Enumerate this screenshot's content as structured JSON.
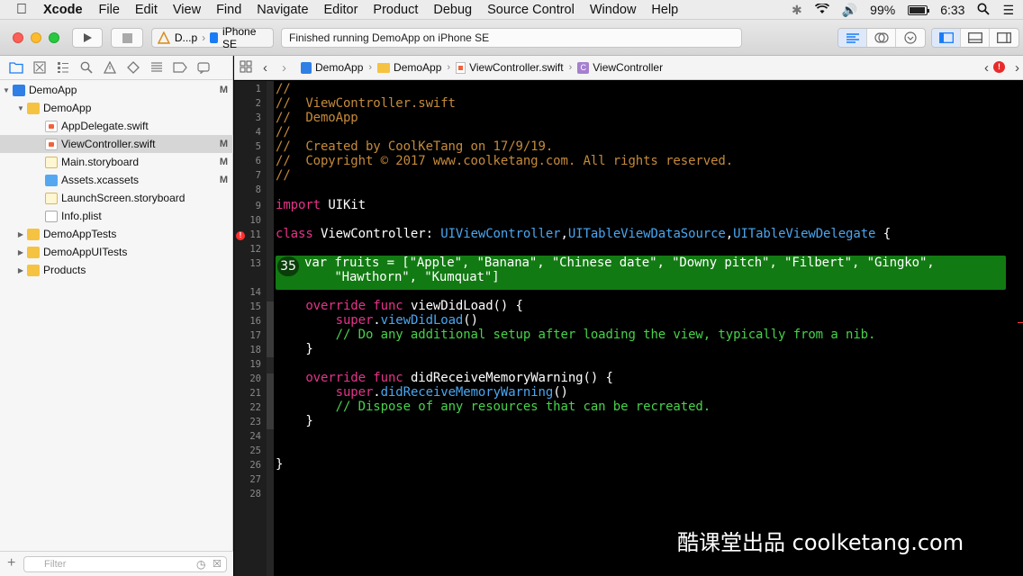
{
  "menubar": {
    "app": "Xcode",
    "items": [
      "File",
      "Edit",
      "View",
      "Find",
      "Navigate",
      "Editor",
      "Product",
      "Debug",
      "Source Control",
      "Window",
      "Help"
    ],
    "battery": "99%",
    "time": "6:33"
  },
  "toolbar": {
    "scheme_target": "D...p",
    "scheme_device": "iPhone SE",
    "status": "Finished running DemoApp on iPhone SE"
  },
  "navigator": {
    "rows": [
      {
        "label": "DemoApp",
        "status": "M",
        "icon": "project-icon"
      },
      {
        "label": "DemoApp",
        "status": "",
        "icon": "folder-icon"
      },
      {
        "label": "AppDelegate.swift",
        "status": "",
        "icon": "swift-file-icon"
      },
      {
        "label": "ViewController.swift",
        "status": "M",
        "icon": "swift-file-icon"
      },
      {
        "label": "Main.storyboard",
        "status": "M",
        "icon": "storyboard-icon"
      },
      {
        "label": "Assets.xcassets",
        "status": "M",
        "icon": "asset-catalog-icon"
      },
      {
        "label": "LaunchScreen.storyboard",
        "status": "",
        "icon": "storyboard-icon"
      },
      {
        "label": "Info.plist",
        "status": "",
        "icon": "plist-icon"
      },
      {
        "label": "DemoAppTests",
        "status": "",
        "icon": "folder-icon"
      },
      {
        "label": "DemoAppUITests",
        "status": "",
        "icon": "folder-icon"
      },
      {
        "label": "Products",
        "status": "",
        "icon": "folder-icon"
      }
    ],
    "filter_placeholder": "Filter"
  },
  "jumpbar": {
    "crumbs": [
      "DemoApp",
      "DemoApp",
      "ViewController.swift",
      "ViewController"
    ]
  },
  "editor": {
    "line_numbers": [
      "1",
      "2",
      "3",
      "4",
      "5",
      "6",
      "7",
      "8",
      "9",
      "10",
      "11",
      "12",
      "13",
      "14",
      "15",
      "16",
      "17",
      "18",
      "19",
      "20",
      "21",
      "22",
      "23",
      "24",
      "25",
      "26",
      "27",
      "28"
    ],
    "lines": {
      "l1": "//",
      "l2": "//  ViewController.swift",
      "l3": "//  DemoApp",
      "l4": "//",
      "l5": "//  Created by CoolKeTang on 17/9/19.",
      "l6": "//  Copyright © 2017 www.coolketang.com. All rights reserved.",
      "l7": "//",
      "l9_kw": "import",
      "l9_rest": " UIKit",
      "l11_kw": "class",
      "l11_name": " ViewController: ",
      "l11_t1": "UIViewController",
      "l11_t2": "UITableViewDataSource",
      "l11_t3": "UITableViewDelegate",
      "l11_end": " {",
      "l13a": "var fruits = [\"Apple\", \"Banana\", \"Chinese date\", \"Downy pitch\", \"Filbert\", \"Gingko\",",
      "l13b": "    \"Hawthorn\", \"Kumquat\"]",
      "l15_kw": "override func",
      "l15_rest": " viewDidLoad() {",
      "l16_kw": "super",
      "l16_m": "viewDidLoad",
      "l16_end": "()",
      "l17": "// Do any additional setup after loading the view, typically from a nib.",
      "l18": "}",
      "l20_kw": "override func",
      "l20_rest": " didReceiveMemoryWarning() {",
      "l21_kw": "super",
      "l21_m": "didReceiveMemoryWarning",
      "l21_end": "()",
      "l22": "// Dispose of any resources that can be recreated.",
      "l23": "}",
      "l26": "}"
    },
    "badge": "35",
    "breakpoint_glyph": "!"
  },
  "watermark": "酷课堂出品 coolketang.com",
  "colors": {
    "highlight": "#127a12",
    "keyword": "#e6338a",
    "type": "#4aa6f0",
    "comment": "#c58a3a",
    "green_comment": "#47d24a",
    "string": "#ff4a4a"
  }
}
